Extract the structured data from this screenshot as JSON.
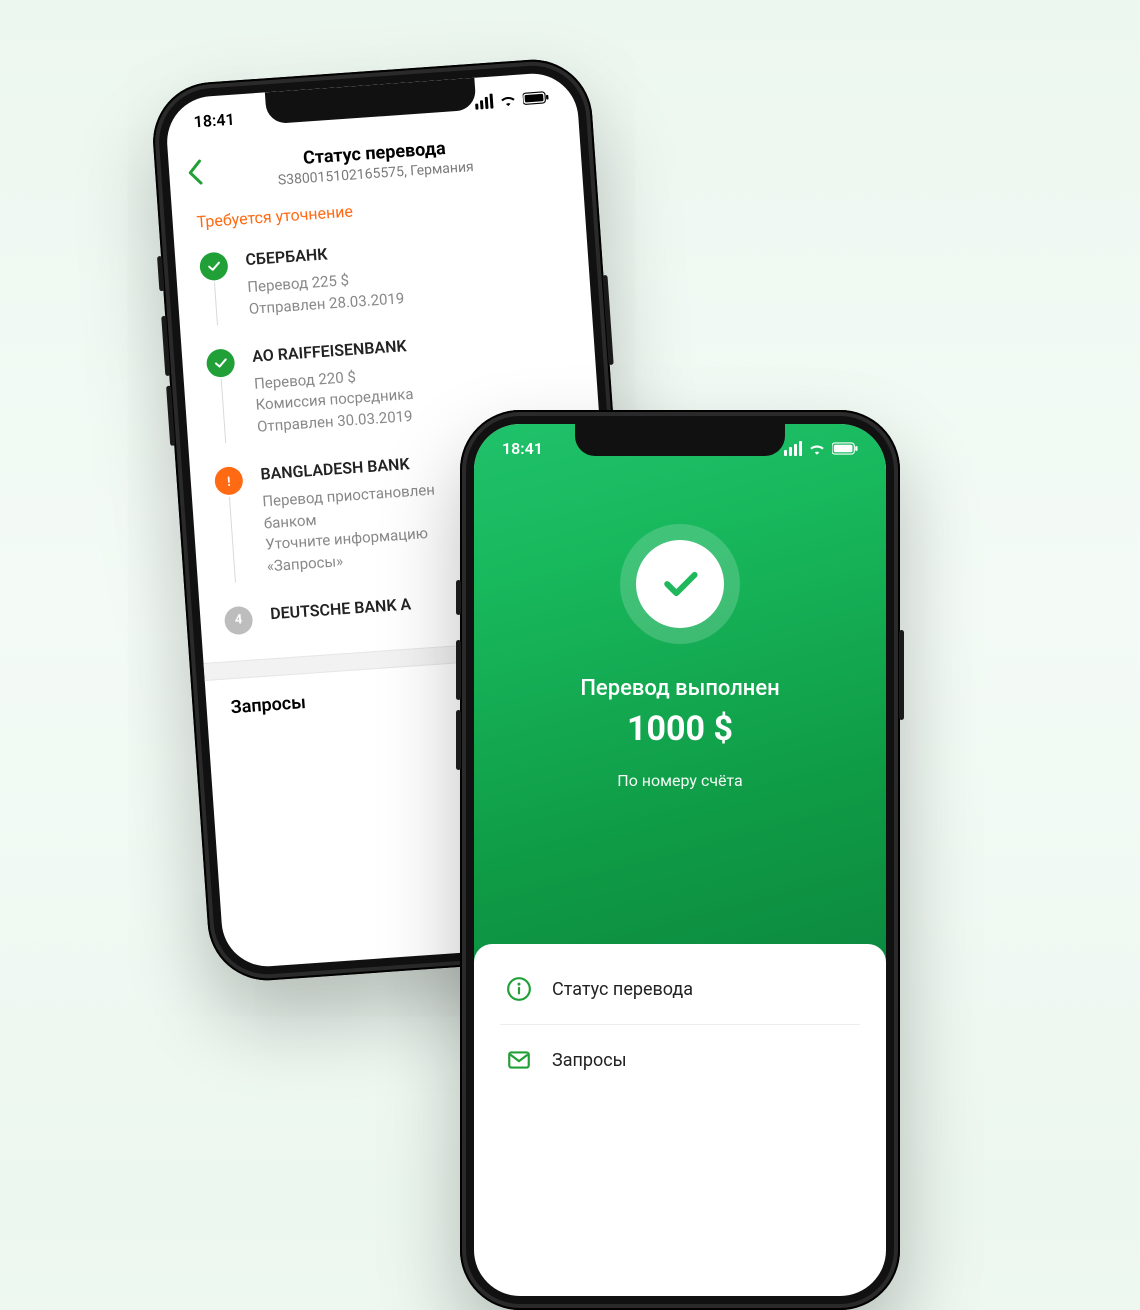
{
  "statusbar": {
    "time": "18:41"
  },
  "phoneA": {
    "header": {
      "title": "Статус перевода",
      "subtitle": "S380015102165575, Германия"
    },
    "warning": "Требуется уточнение",
    "steps": [
      {
        "status": "done",
        "bank": "СБЕРБАНК",
        "lines": [
          "Перевод 225 $",
          "Отправлен 28.03.2019"
        ]
      },
      {
        "status": "done",
        "bank": "AO RAIFFEISENBANK",
        "lines": [
          "Перевод 220 $",
          "Комиссия посредника",
          "Отправлен 30.03.2019"
        ]
      },
      {
        "status": "warn",
        "bank": "BANGLADESH BANK",
        "lines": [
          "Перевод приостановлен",
          "банком",
          "Уточните информацию",
          "«Запросы»"
        ]
      },
      {
        "status": "pending",
        "pending_number": "4",
        "bank": "DEUTSCHE BANK A",
        "lines": []
      }
    ],
    "requests_title": "Запросы"
  },
  "phoneB": {
    "hero": {
      "title": "Перевод выполнен",
      "amount": "1000 $",
      "subtitle": "По номеру счёта"
    },
    "rows": [
      {
        "icon": "info",
        "label": "Статус перевода"
      },
      {
        "icon": "mail",
        "label": "Запросы"
      }
    ]
  },
  "colors": {
    "green": "#21a038",
    "orange": "#ff6a13",
    "gray": "#bdbdbd"
  }
}
